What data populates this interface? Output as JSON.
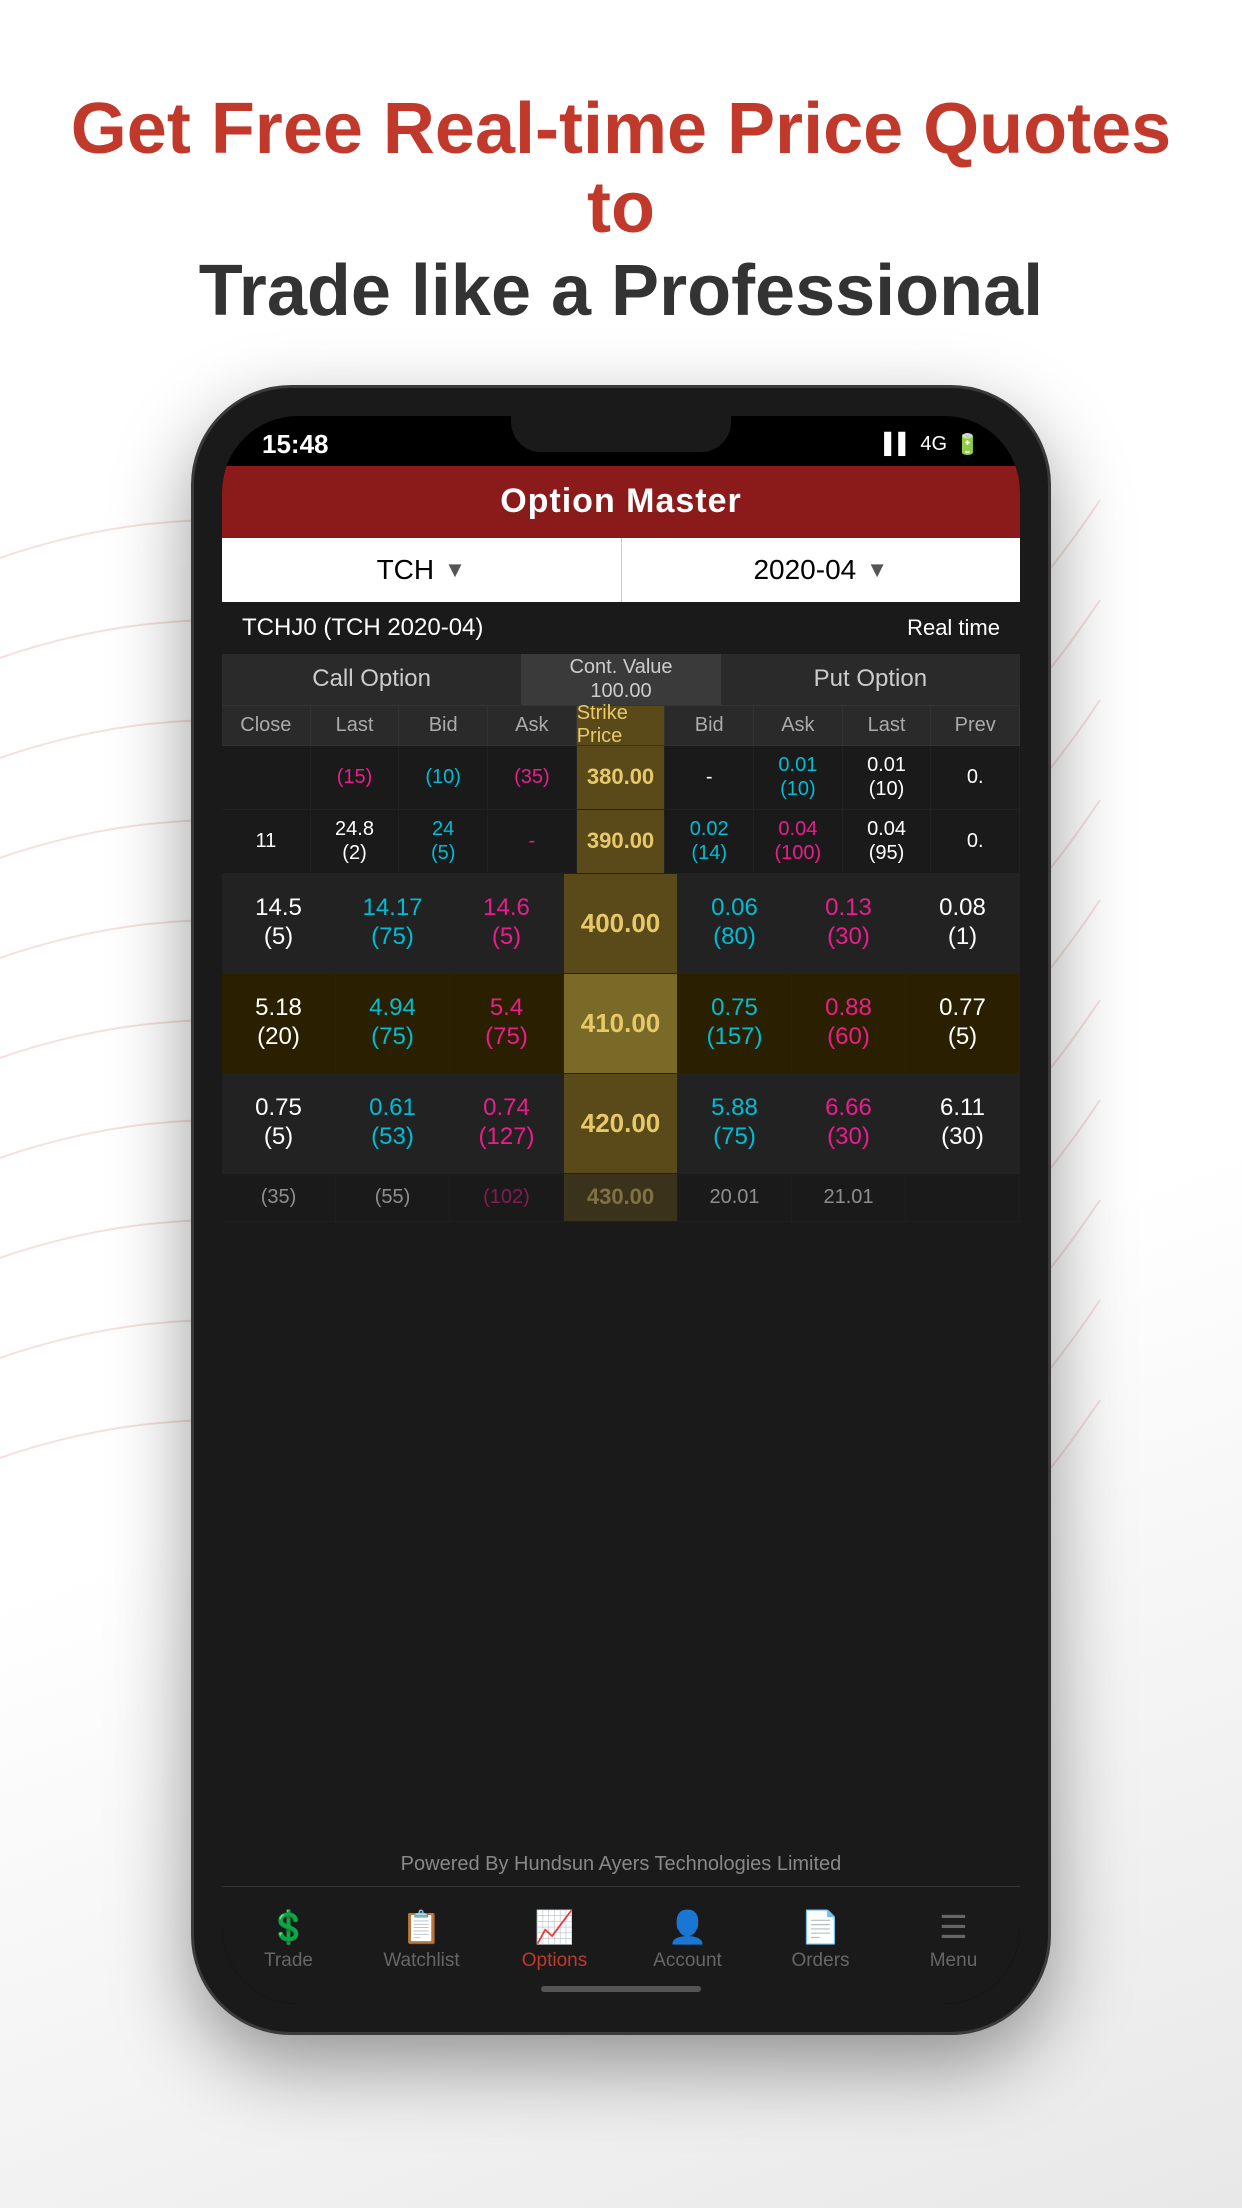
{
  "header": {
    "line1": "Get Free Real-time Price Quotes to",
    "line2": "Trade like a Professional"
  },
  "phone": {
    "status_time": "15:48",
    "status_signal": "▌▌",
    "status_network": "4G",
    "app_title": "Option Master",
    "dropdown1_label": "TCH",
    "dropdown2_label": "2020-04",
    "ticker_info": "TCHJ0 (TCH 2020-04)",
    "realtime_label": "Real time",
    "call_option_label": "Call Option",
    "cont_value_label": "Cont. Value",
    "cont_value": "100.00",
    "put_option_label": "Put Option",
    "sub_headers": [
      "Close",
      "Last",
      "Bid",
      "Ask",
      "Strike Price",
      "Bid",
      "Ask",
      "Last",
      "Prev"
    ],
    "rows": [
      {
        "close": "",
        "last_call": "(15)",
        "bid_call": "(10)",
        "ask_call": "(35)",
        "strike": "380.00",
        "bid_put": "-",
        "ask_put": "0.01\n(10)",
        "last_put": "0.01\n(10)",
        "prev_put": "0."
      },
      {
        "close": "11",
        "last_call": "24.8\n(2)",
        "bid_call": "24\n(5)",
        "ask_call": "-",
        "strike": "390.00",
        "bid_put": "0.02\n(14)",
        "ask_put": "0.04\n(100)",
        "last_put": "0.04\n(95)",
        "prev_put": "0."
      },
      {
        "close": "",
        "last_call": "14.17\n(75)",
        "bid_call": "14.6\n(5)",
        "ask_call": "14.5\n(5)",
        "strike": "400.00",
        "bid_put": "0.06\n(80)",
        "ask_put": "0.13\n(30)",
        "last_put": "0.08\n(1)",
        "is_expanded": true
      },
      {
        "close": "",
        "last_call": "4.94\n(75)",
        "bid_call": "5.4\n(75)",
        "ask_call": "5.18\n(20)",
        "strike": "410.00",
        "bid_put": "0.75\n(157)",
        "ask_put": "0.88\n(60)",
        "last_put": "0.77\n(5)",
        "is_expanded": true
      },
      {
        "close": "",
        "last_call": "0.61\n(53)",
        "bid_call": "0.74\n(127)",
        "ask_call": "0.75\n(5)",
        "strike": "420.00",
        "bid_put": "5.88\n(75)",
        "ask_put": "6.66\n(30)",
        "last_put": "6.11\n(30)",
        "is_expanded": true
      }
    ],
    "powered_by": "Powered By Hundsun Ayers Technologies Limited",
    "nav_items": [
      {
        "icon": "💲",
        "label": "Trade",
        "active": false
      },
      {
        "icon": "📋",
        "label": "Watchlist",
        "active": false
      },
      {
        "icon": "📈",
        "label": "Options",
        "active": true
      },
      {
        "icon": "👤",
        "label": "Account",
        "active": false
      },
      {
        "icon": "📄",
        "label": "Orders",
        "active": false
      },
      {
        "icon": "☰",
        "label": "Menu",
        "active": false
      }
    ]
  }
}
